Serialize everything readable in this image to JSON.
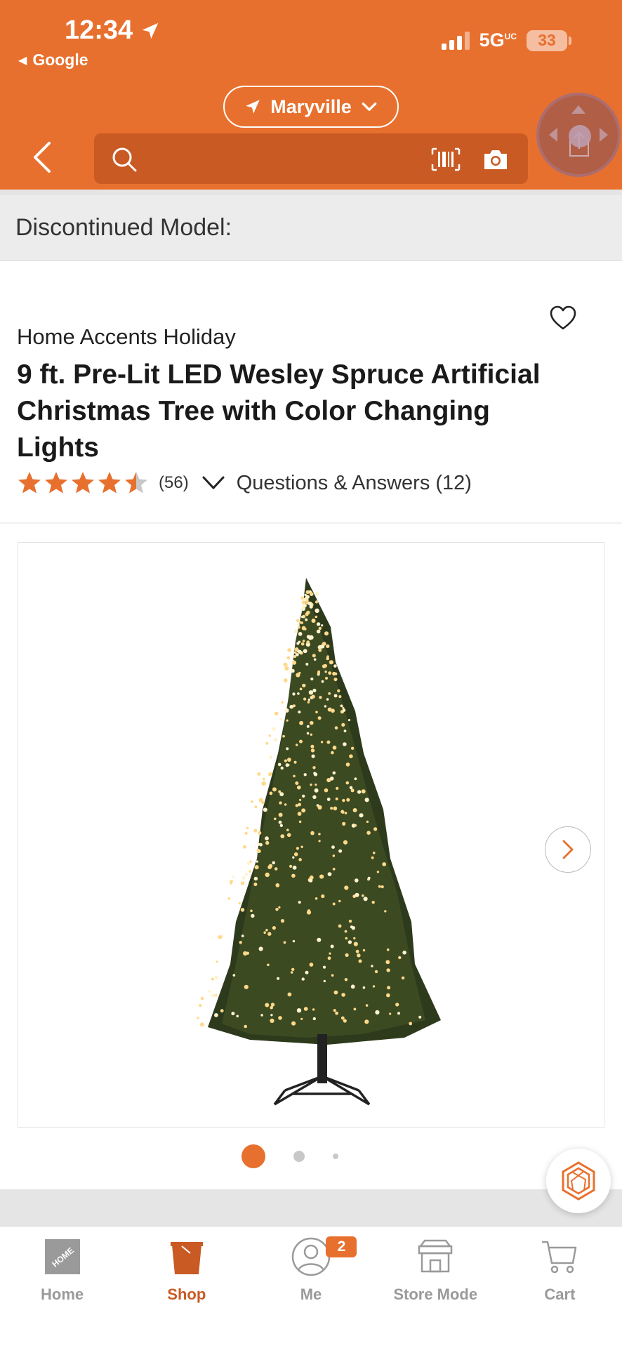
{
  "status_bar": {
    "time": "12:34",
    "back_app": "Google",
    "network": "5G",
    "network_sup": "UC",
    "battery": "33"
  },
  "header": {
    "location": "Maryville",
    "search_placeholder": "",
    "colors": {
      "brand": "#e8702e",
      "search_bg": "#c95a23"
    }
  },
  "banner": {
    "discontinued": "Discontinued Model:"
  },
  "product": {
    "brand": "Home Accents Holiday",
    "title": "9 ft. Pre-Lit LED Wesley Spruce Artificial Christmas Tree with Color Changing Lights",
    "rating": 4.5,
    "rating_max": 5,
    "review_count": "(56)",
    "qa_link": "Questions & Answers (12)",
    "image_pager": {
      "current": 1,
      "total": 3
    }
  },
  "tabbar": {
    "items": [
      {
        "label": "Home",
        "icon": "home-depot-logo-icon",
        "active": false
      },
      {
        "label": "Shop",
        "icon": "bucket-icon",
        "active": true
      },
      {
        "label": "Me",
        "icon": "person-icon",
        "active": false,
        "badge": "2"
      },
      {
        "label": "Store Mode",
        "icon": "store-icon",
        "active": false
      },
      {
        "label": "Cart",
        "icon": "cart-icon",
        "active": false
      }
    ]
  }
}
